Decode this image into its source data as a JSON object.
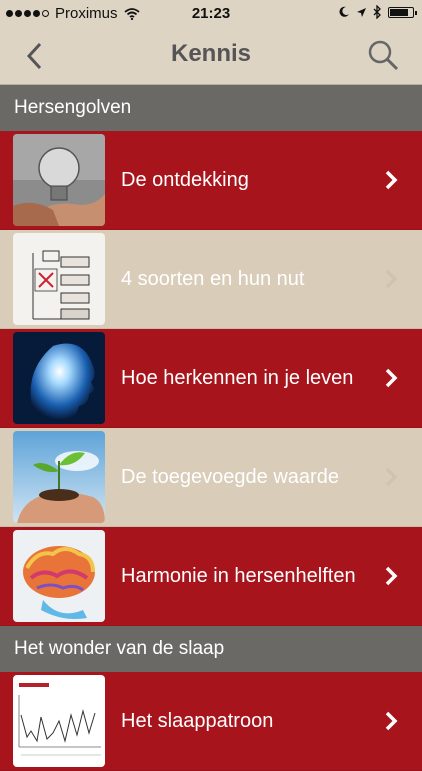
{
  "status": {
    "carrier": "Proximus",
    "time": "21:23"
  },
  "nav": {
    "title": "Kennis",
    "back_icon": "chevron-left-icon",
    "search_icon": "search-icon"
  },
  "sections": [
    {
      "title": "Hersengolven",
      "items": [
        {
          "label": "De ontdekking",
          "thumb": "lightbulb-image",
          "style": "red"
        },
        {
          "label": "4 soorten en hun nut",
          "thumb": "brainwave-diagram-image",
          "style": "beige"
        },
        {
          "label": "Hoe herkennen in je leven",
          "thumb": "glowing-head-image",
          "style": "red"
        },
        {
          "label": "De toegevoegde waarde",
          "thumb": "sprout-in-hands-image",
          "style": "beige"
        },
        {
          "label": "Harmonie in hersenhelften",
          "thumb": "colorful-brain-image",
          "style": "red"
        }
      ]
    },
    {
      "title": "Het wonder van de slaap",
      "items": [
        {
          "label": "Het slaappatroon",
          "thumb": "sleep-chart-image",
          "style": "red"
        }
      ]
    }
  ],
  "colors": {
    "header_bg": "#ded4c4",
    "section_bg": "#6b6966",
    "row_red": "#a8141c",
    "row_beige": "#d9ccb9"
  }
}
